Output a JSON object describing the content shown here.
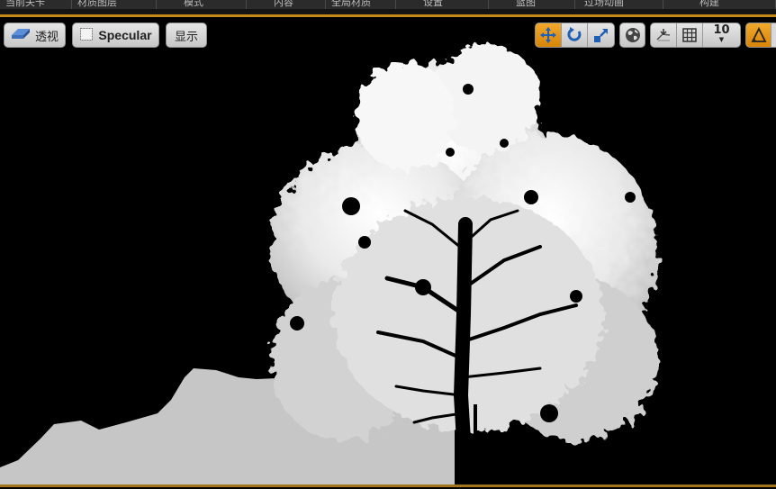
{
  "top_menu": [
    "当前关卡",
    "材质图层",
    "模式",
    "内容",
    "全局材质",
    "设置",
    "蓝图",
    "过场动画",
    "构建"
  ],
  "viewport_toolbar": {
    "perspective_label": "透视",
    "view_mode_label": "Specular",
    "show_label": "显示",
    "grid_snap_value": "10",
    "transform_tools": [
      "translate-icon",
      "rotate-icon",
      "scale-icon"
    ]
  },
  "colors": {
    "accent": "#c38a1a",
    "button_bg": "#d6d6d6",
    "active_tool": "#e8961a",
    "viewport_bg": "#000000",
    "terrain": "#c6c6c6"
  }
}
